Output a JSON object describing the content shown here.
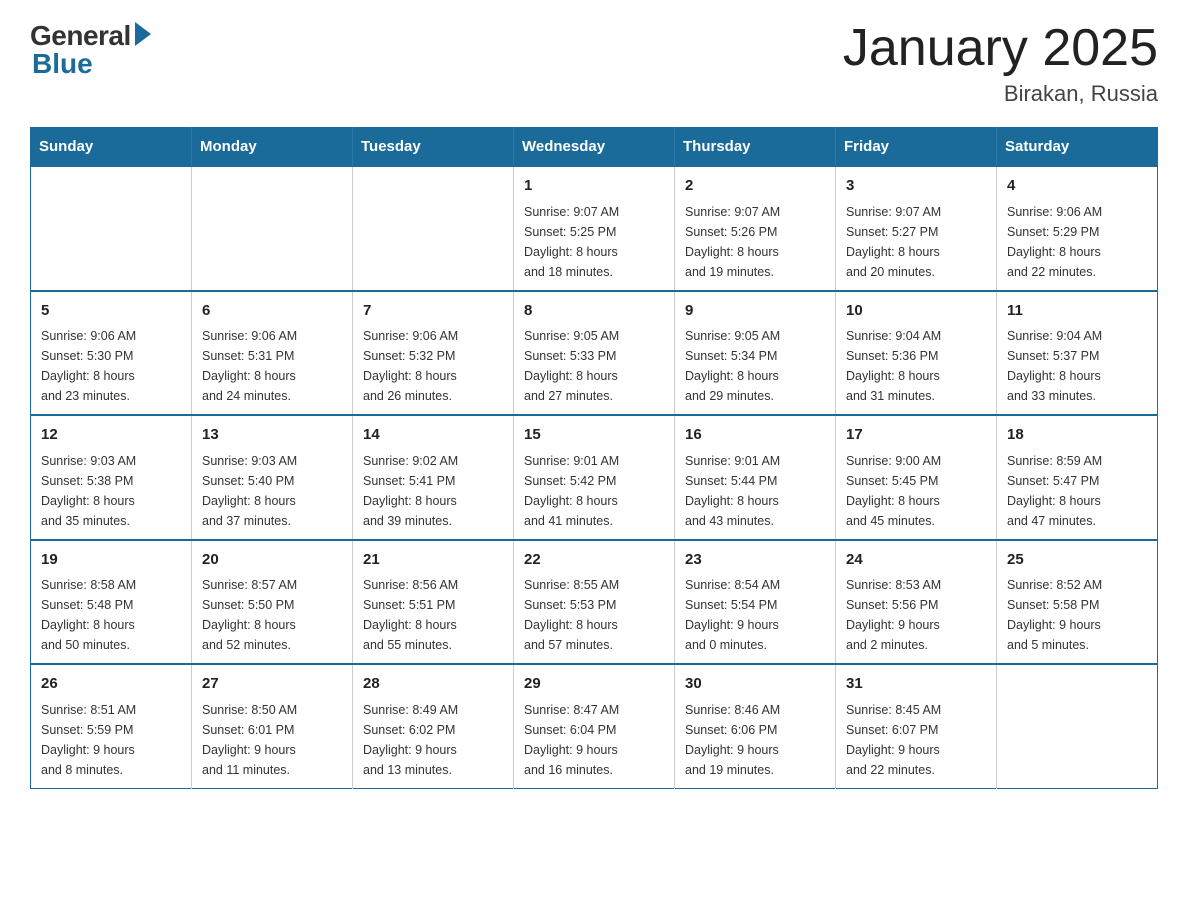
{
  "logo": {
    "general": "General",
    "blue": "Blue"
  },
  "header": {
    "title": "January 2025",
    "location": "Birakan, Russia"
  },
  "calendar": {
    "days_of_week": [
      "Sunday",
      "Monday",
      "Tuesday",
      "Wednesday",
      "Thursday",
      "Friday",
      "Saturday"
    ],
    "weeks": [
      [
        {
          "day": "",
          "info": ""
        },
        {
          "day": "",
          "info": ""
        },
        {
          "day": "",
          "info": ""
        },
        {
          "day": "1",
          "info": "Sunrise: 9:07 AM\nSunset: 5:25 PM\nDaylight: 8 hours\nand 18 minutes."
        },
        {
          "day": "2",
          "info": "Sunrise: 9:07 AM\nSunset: 5:26 PM\nDaylight: 8 hours\nand 19 minutes."
        },
        {
          "day": "3",
          "info": "Sunrise: 9:07 AM\nSunset: 5:27 PM\nDaylight: 8 hours\nand 20 minutes."
        },
        {
          "day": "4",
          "info": "Sunrise: 9:06 AM\nSunset: 5:29 PM\nDaylight: 8 hours\nand 22 minutes."
        }
      ],
      [
        {
          "day": "5",
          "info": "Sunrise: 9:06 AM\nSunset: 5:30 PM\nDaylight: 8 hours\nand 23 minutes."
        },
        {
          "day": "6",
          "info": "Sunrise: 9:06 AM\nSunset: 5:31 PM\nDaylight: 8 hours\nand 24 minutes."
        },
        {
          "day": "7",
          "info": "Sunrise: 9:06 AM\nSunset: 5:32 PM\nDaylight: 8 hours\nand 26 minutes."
        },
        {
          "day": "8",
          "info": "Sunrise: 9:05 AM\nSunset: 5:33 PM\nDaylight: 8 hours\nand 27 minutes."
        },
        {
          "day": "9",
          "info": "Sunrise: 9:05 AM\nSunset: 5:34 PM\nDaylight: 8 hours\nand 29 minutes."
        },
        {
          "day": "10",
          "info": "Sunrise: 9:04 AM\nSunset: 5:36 PM\nDaylight: 8 hours\nand 31 minutes."
        },
        {
          "day": "11",
          "info": "Sunrise: 9:04 AM\nSunset: 5:37 PM\nDaylight: 8 hours\nand 33 minutes."
        }
      ],
      [
        {
          "day": "12",
          "info": "Sunrise: 9:03 AM\nSunset: 5:38 PM\nDaylight: 8 hours\nand 35 minutes."
        },
        {
          "day": "13",
          "info": "Sunrise: 9:03 AM\nSunset: 5:40 PM\nDaylight: 8 hours\nand 37 minutes."
        },
        {
          "day": "14",
          "info": "Sunrise: 9:02 AM\nSunset: 5:41 PM\nDaylight: 8 hours\nand 39 minutes."
        },
        {
          "day": "15",
          "info": "Sunrise: 9:01 AM\nSunset: 5:42 PM\nDaylight: 8 hours\nand 41 minutes."
        },
        {
          "day": "16",
          "info": "Sunrise: 9:01 AM\nSunset: 5:44 PM\nDaylight: 8 hours\nand 43 minutes."
        },
        {
          "day": "17",
          "info": "Sunrise: 9:00 AM\nSunset: 5:45 PM\nDaylight: 8 hours\nand 45 minutes."
        },
        {
          "day": "18",
          "info": "Sunrise: 8:59 AM\nSunset: 5:47 PM\nDaylight: 8 hours\nand 47 minutes."
        }
      ],
      [
        {
          "day": "19",
          "info": "Sunrise: 8:58 AM\nSunset: 5:48 PM\nDaylight: 8 hours\nand 50 minutes."
        },
        {
          "day": "20",
          "info": "Sunrise: 8:57 AM\nSunset: 5:50 PM\nDaylight: 8 hours\nand 52 minutes."
        },
        {
          "day": "21",
          "info": "Sunrise: 8:56 AM\nSunset: 5:51 PM\nDaylight: 8 hours\nand 55 minutes."
        },
        {
          "day": "22",
          "info": "Sunrise: 8:55 AM\nSunset: 5:53 PM\nDaylight: 8 hours\nand 57 minutes."
        },
        {
          "day": "23",
          "info": "Sunrise: 8:54 AM\nSunset: 5:54 PM\nDaylight: 9 hours\nand 0 minutes."
        },
        {
          "day": "24",
          "info": "Sunrise: 8:53 AM\nSunset: 5:56 PM\nDaylight: 9 hours\nand 2 minutes."
        },
        {
          "day": "25",
          "info": "Sunrise: 8:52 AM\nSunset: 5:58 PM\nDaylight: 9 hours\nand 5 minutes."
        }
      ],
      [
        {
          "day": "26",
          "info": "Sunrise: 8:51 AM\nSunset: 5:59 PM\nDaylight: 9 hours\nand 8 minutes."
        },
        {
          "day": "27",
          "info": "Sunrise: 8:50 AM\nSunset: 6:01 PM\nDaylight: 9 hours\nand 11 minutes."
        },
        {
          "day": "28",
          "info": "Sunrise: 8:49 AM\nSunset: 6:02 PM\nDaylight: 9 hours\nand 13 minutes."
        },
        {
          "day": "29",
          "info": "Sunrise: 8:47 AM\nSunset: 6:04 PM\nDaylight: 9 hours\nand 16 minutes."
        },
        {
          "day": "30",
          "info": "Sunrise: 8:46 AM\nSunset: 6:06 PM\nDaylight: 9 hours\nand 19 minutes."
        },
        {
          "day": "31",
          "info": "Sunrise: 8:45 AM\nSunset: 6:07 PM\nDaylight: 9 hours\nand 22 minutes."
        },
        {
          "day": "",
          "info": ""
        }
      ]
    ]
  }
}
